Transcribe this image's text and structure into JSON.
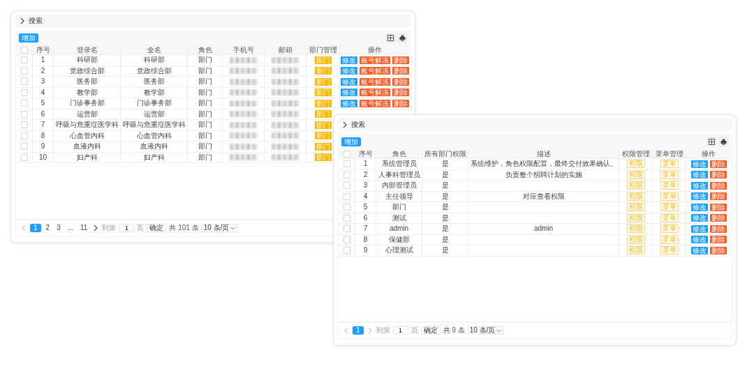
{
  "windows": [
    {
      "search": {
        "label": "搜索",
        "expanded": false
      },
      "add_button": "增加",
      "columns": [
        {
          "kind": "checkbox",
          "checked": false
        },
        {
          "kind": "text",
          "text": "序号"
        },
        {
          "kind": "text",
          "text": "登录名"
        },
        {
          "kind": "text",
          "text": "全名"
        },
        {
          "kind": "text",
          "text": "角色"
        },
        {
          "kind": "text",
          "text": "手机号"
        },
        {
          "kind": "text",
          "text": "邮箱"
        },
        {
          "kind": "text",
          "text": "部门管理"
        },
        {
          "kind": "text",
          "text": "操作"
        }
      ],
      "rows": [
        [
          {
            "kind": "checkbox",
            "checked": false
          },
          {
            "kind": "text",
            "text": "1"
          },
          {
            "kind": "text",
            "text": "科研部"
          },
          {
            "kind": "text",
            "text": "科研部"
          },
          {
            "kind": "text",
            "text": "部门"
          },
          {
            "kind": "redacted"
          },
          {
            "kind": "redacted"
          },
          {
            "kind": "tag",
            "text": "部门"
          },
          {
            "kind": "actions",
            "buttons": [
              {
                "label": "修改",
                "kind": "primary"
              },
              {
                "label": "账号解冻",
                "kind": "danger"
              },
              {
                "label": "删除",
                "kind": "danger"
              }
            ]
          }
        ],
        [
          {
            "kind": "checkbox",
            "checked": false
          },
          {
            "kind": "text",
            "text": "2"
          },
          {
            "kind": "text",
            "text": "党政综合部"
          },
          {
            "kind": "text",
            "text": "党政综合部"
          },
          {
            "kind": "text",
            "text": "部门"
          },
          {
            "kind": "redacted"
          },
          {
            "kind": "redacted"
          },
          {
            "kind": "tag",
            "text": "部门"
          },
          {
            "kind": "actions",
            "buttons": [
              {
                "label": "修改",
                "kind": "primary"
              },
              {
                "label": "账号解冻",
                "kind": "danger"
              },
              {
                "label": "删除",
                "kind": "danger"
              }
            ]
          }
        ],
        [
          {
            "kind": "checkbox",
            "checked": false
          },
          {
            "kind": "text",
            "text": "3"
          },
          {
            "kind": "text",
            "text": "医务部"
          },
          {
            "kind": "text",
            "text": "医务部"
          },
          {
            "kind": "text",
            "text": "部门"
          },
          {
            "kind": "redacted"
          },
          {
            "kind": "redacted"
          },
          {
            "kind": "tag",
            "text": "部门"
          },
          {
            "kind": "actions",
            "buttons": [
              {
                "label": "修改",
                "kind": "primary"
              },
              {
                "label": "账号解冻",
                "kind": "danger"
              },
              {
                "label": "删除",
                "kind": "danger"
              }
            ]
          }
        ],
        [
          {
            "kind": "checkbox",
            "checked": false
          },
          {
            "kind": "text",
            "text": "4"
          },
          {
            "kind": "text",
            "text": "教学部"
          },
          {
            "kind": "text",
            "text": "教学部"
          },
          {
            "kind": "text",
            "text": "部门"
          },
          {
            "kind": "redacted"
          },
          {
            "kind": "redacted"
          },
          {
            "kind": "tag",
            "text": "部门"
          },
          {
            "kind": "actions",
            "buttons": [
              {
                "label": "修改",
                "kind": "primary"
              },
              {
                "label": "账号解冻",
                "kind": "danger"
              },
              {
                "label": "删除",
                "kind": "danger"
              }
            ]
          }
        ],
        [
          {
            "kind": "checkbox",
            "checked": false
          },
          {
            "kind": "text",
            "text": "5"
          },
          {
            "kind": "text",
            "text": "门诊事务部"
          },
          {
            "kind": "text",
            "text": "门诊事务部"
          },
          {
            "kind": "text",
            "text": "部门"
          },
          {
            "kind": "redacted"
          },
          {
            "kind": "redacted"
          },
          {
            "kind": "tag",
            "text": "部门"
          },
          {
            "kind": "actions",
            "buttons": [
              {
                "label": "修改",
                "kind": "primary"
              },
              {
                "label": "账号解冻",
                "kind": "danger"
              },
              {
                "label": "删除",
                "kind": "danger"
              }
            ]
          }
        ],
        [
          {
            "kind": "checkbox",
            "checked": false
          },
          {
            "kind": "text",
            "text": "6"
          },
          {
            "kind": "text",
            "text": "运营部"
          },
          {
            "kind": "text",
            "text": "运营部"
          },
          {
            "kind": "text",
            "text": "部门"
          },
          {
            "kind": "redacted"
          },
          {
            "kind": "redacted"
          },
          {
            "kind": "tag",
            "text": "部门"
          }
        ],
        [
          {
            "kind": "checkbox",
            "checked": false
          },
          {
            "kind": "text",
            "text": "7"
          },
          {
            "kind": "text",
            "text": "呼吸与危重症医学科"
          },
          {
            "kind": "text",
            "text": "呼吸与危重症医学科"
          },
          {
            "kind": "text",
            "text": "部门"
          },
          {
            "kind": "redacted"
          },
          {
            "kind": "redacted"
          },
          {
            "kind": "tag",
            "text": "部门"
          }
        ],
        [
          {
            "kind": "checkbox",
            "checked": false
          },
          {
            "kind": "text",
            "text": "8"
          },
          {
            "kind": "text",
            "text": "心血管内科"
          },
          {
            "kind": "text",
            "text": "心血管内科"
          },
          {
            "kind": "text",
            "text": "部门"
          },
          {
            "kind": "redacted"
          },
          {
            "kind": "redacted"
          },
          {
            "kind": "tag",
            "text": "部门"
          }
        ],
        [
          {
            "kind": "checkbox",
            "checked": false
          },
          {
            "kind": "text",
            "text": "9"
          },
          {
            "kind": "text",
            "text": "血液内科"
          },
          {
            "kind": "text",
            "text": "血液内科"
          },
          {
            "kind": "text",
            "text": "部门"
          },
          {
            "kind": "redacted"
          },
          {
            "kind": "redacted"
          },
          {
            "kind": "tag",
            "text": "部门"
          }
        ],
        [
          {
            "kind": "checkbox",
            "checked": false
          },
          {
            "kind": "text",
            "text": "10"
          },
          {
            "kind": "text",
            "text": "妇产科"
          },
          {
            "kind": "text",
            "text": "妇产科"
          },
          {
            "kind": "text",
            "text": "部门"
          },
          {
            "kind": "redacted"
          },
          {
            "kind": "redacted"
          },
          {
            "kind": "tag",
            "text": "部门"
          }
        ]
      ],
      "pagination": {
        "prev_disabled": true,
        "next_disabled": false,
        "pages": [
          {
            "label": "1",
            "selected": true
          },
          {
            "label": "2",
            "selected": false
          },
          {
            "label": "3",
            "selected": false
          },
          {
            "label": "...",
            "selected": false
          },
          {
            "label": "11",
            "selected": false
          }
        ],
        "jump_prefix": "到第",
        "jump_value": "1",
        "jump_suffix": "页",
        "confirm": "确定",
        "total": "共 101 条",
        "page_size": "10 条/页"
      }
    },
    {
      "search": {
        "label": "搜索",
        "expanded": false
      },
      "add_button": "增加",
      "columns": [
        {
          "kind": "checkbox",
          "checked": false
        },
        {
          "kind": "text",
          "text": "序号"
        },
        {
          "kind": "text",
          "text": "角色"
        },
        {
          "kind": "text",
          "text": "所有部门权限"
        },
        {
          "kind": "text",
          "text": "描述"
        },
        {
          "kind": "text",
          "text": "权限管理"
        },
        {
          "kind": "text",
          "text": "菜单管理"
        },
        {
          "kind": "text",
          "text": "操作"
        }
      ],
      "rows": [
        [
          {
            "kind": "checkbox",
            "checked": false
          },
          {
            "kind": "text",
            "text": "1"
          },
          {
            "kind": "text",
            "text": "系统管理员"
          },
          {
            "kind": "text",
            "text": "是"
          },
          {
            "kind": "text",
            "text": "系统维护，角色权限配置，最终交付效果确认。"
          },
          {
            "kind": "outline_tag",
            "text": "权限"
          },
          {
            "kind": "outline_tag",
            "text": "菜单"
          },
          {
            "kind": "actions",
            "buttons": [
              {
                "label": "修改",
                "kind": "primary"
              },
              {
                "label": "删除",
                "kind": "danger"
              }
            ]
          }
        ],
        [
          {
            "kind": "checkbox",
            "checked": false
          },
          {
            "kind": "text",
            "text": "2"
          },
          {
            "kind": "text",
            "text": "人事科管理员"
          },
          {
            "kind": "text",
            "text": "是"
          },
          {
            "kind": "text",
            "text": "负责整个招聘计划的实施"
          },
          {
            "kind": "outline_tag",
            "text": "权限"
          },
          {
            "kind": "outline_tag",
            "text": "菜单"
          },
          {
            "kind": "actions",
            "buttons": [
              {
                "label": "修改",
                "kind": "primary"
              },
              {
                "label": "删除",
                "kind": "danger"
              }
            ]
          }
        ],
        [
          {
            "kind": "checkbox",
            "checked": false
          },
          {
            "kind": "text",
            "text": "3"
          },
          {
            "kind": "text",
            "text": "内部管理员"
          },
          {
            "kind": "text",
            "text": "是"
          },
          {
            "kind": "empty"
          },
          {
            "kind": "outline_tag",
            "text": "权限"
          },
          {
            "kind": "outline_tag",
            "text": "菜单"
          },
          {
            "kind": "actions",
            "buttons": [
              {
                "label": "修改",
                "kind": "primary"
              },
              {
                "label": "删除",
                "kind": "danger"
              }
            ]
          }
        ],
        [
          {
            "kind": "checkbox",
            "checked": false
          },
          {
            "kind": "text",
            "text": "4"
          },
          {
            "kind": "text",
            "text": "主任领导"
          },
          {
            "kind": "text",
            "text": "是"
          },
          {
            "kind": "text",
            "text": "对应查看权限"
          },
          {
            "kind": "outline_tag",
            "text": "权限"
          },
          {
            "kind": "outline_tag",
            "text": "菜单"
          },
          {
            "kind": "actions",
            "buttons": [
              {
                "label": "修改",
                "kind": "primary"
              },
              {
                "label": "删除",
                "kind": "danger"
              }
            ]
          }
        ],
        [
          {
            "kind": "checkbox",
            "checked": false
          },
          {
            "kind": "text",
            "text": "5"
          },
          {
            "kind": "text",
            "text": "部门"
          },
          {
            "kind": "text",
            "text": "是"
          },
          {
            "kind": "empty"
          },
          {
            "kind": "outline_tag",
            "text": "权限"
          },
          {
            "kind": "outline_tag",
            "text": "菜单"
          },
          {
            "kind": "actions",
            "buttons": [
              {
                "label": "修改",
                "kind": "primary"
              },
              {
                "label": "删除",
                "kind": "danger"
              }
            ]
          }
        ],
        [
          {
            "kind": "checkbox",
            "checked": false
          },
          {
            "kind": "text",
            "text": "6"
          },
          {
            "kind": "text",
            "text": "测试"
          },
          {
            "kind": "text",
            "text": "是"
          },
          {
            "kind": "empty"
          },
          {
            "kind": "outline_tag",
            "text": "权限"
          },
          {
            "kind": "outline_tag",
            "text": "菜单"
          },
          {
            "kind": "actions",
            "buttons": [
              {
                "label": "修改",
                "kind": "primary"
              },
              {
                "label": "删除",
                "kind": "danger"
              }
            ]
          }
        ],
        [
          {
            "kind": "checkbox",
            "checked": false
          },
          {
            "kind": "text",
            "text": "7"
          },
          {
            "kind": "text",
            "text": "admin"
          },
          {
            "kind": "text",
            "text": "是"
          },
          {
            "kind": "text",
            "text": "admin"
          },
          {
            "kind": "outline_tag",
            "text": "权限"
          },
          {
            "kind": "outline_tag",
            "text": "菜单"
          },
          {
            "kind": "actions",
            "buttons": [
              {
                "label": "修改",
                "kind": "primary"
              },
              {
                "label": "删除",
                "kind": "danger"
              }
            ]
          }
        ],
        [
          {
            "kind": "checkbox",
            "checked": false
          },
          {
            "kind": "text",
            "text": "8"
          },
          {
            "kind": "text",
            "text": "保健部"
          },
          {
            "kind": "text",
            "text": "是"
          },
          {
            "kind": "empty"
          },
          {
            "kind": "outline_tag",
            "text": "权限"
          },
          {
            "kind": "outline_tag",
            "text": "菜单"
          },
          {
            "kind": "actions",
            "buttons": [
              {
                "label": "修改",
                "kind": "primary"
              },
              {
                "label": "删除",
                "kind": "danger"
              }
            ]
          }
        ],
        [
          {
            "kind": "checkbox",
            "checked": false
          },
          {
            "kind": "text",
            "text": "9"
          },
          {
            "kind": "text",
            "text": "心理测试"
          },
          {
            "kind": "text",
            "text": "是"
          },
          {
            "kind": "empty"
          },
          {
            "kind": "outline_tag",
            "text": "权限"
          },
          {
            "kind": "outline_tag",
            "text": "菜单"
          },
          {
            "kind": "actions",
            "buttons": [
              {
                "label": "修改",
                "kind": "primary"
              },
              {
                "label": "删除",
                "kind": "danger"
              }
            ]
          }
        ]
      ],
      "pagination": {
        "prev_disabled": true,
        "next_disabled": true,
        "pages": [
          {
            "label": "1",
            "selected": true
          }
        ],
        "jump_prefix": "到第",
        "jump_value": "1",
        "jump_suffix": "页",
        "confirm": "确定",
        "total": "共 9 条",
        "page_size": "10 条/页"
      }
    }
  ]
}
